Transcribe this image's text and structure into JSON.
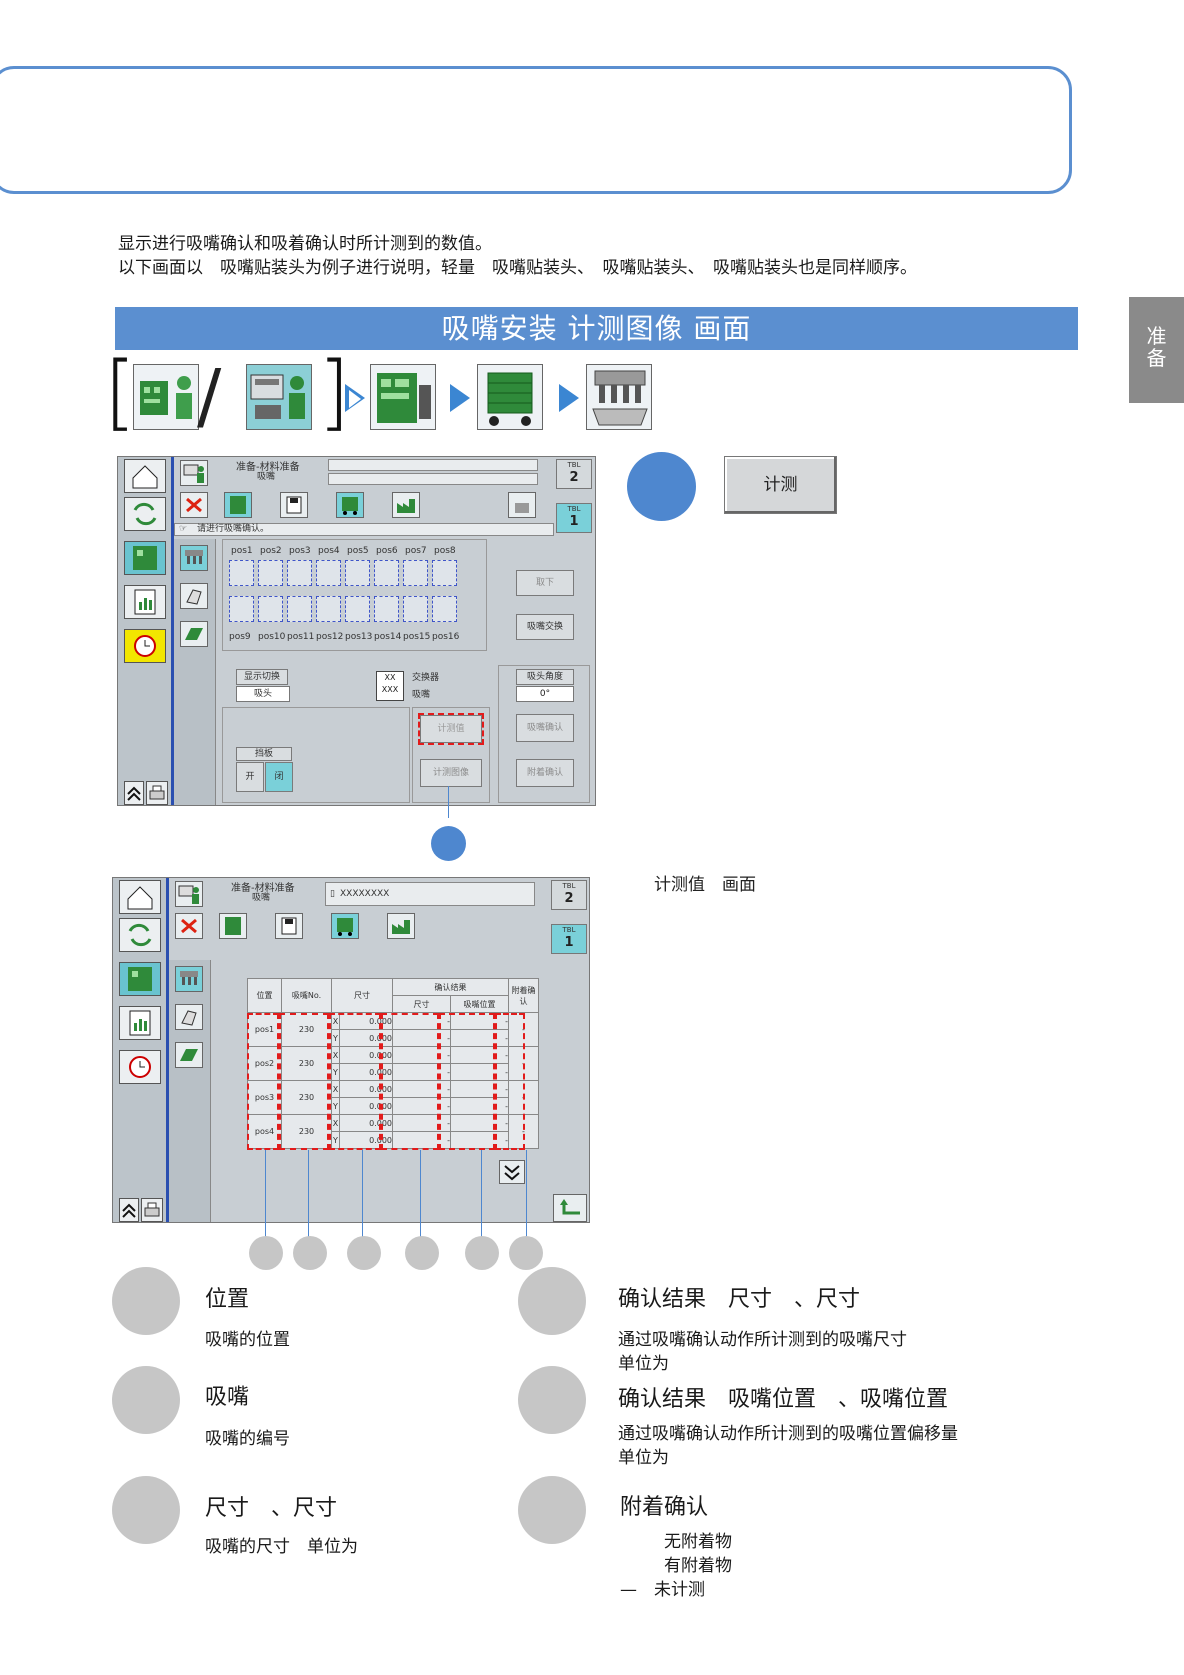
{
  "intro": {
    "line1": "显示进行吸嘴确认和吸着确认时所计测到的数值。",
    "line2": "以下画面以　吸嘴贴装头为例子进行说明，轻量　吸嘴贴装头、　吸嘴贴装头、　吸嘴贴装头也是同样顺序。"
  },
  "side_tab": {
    "line1": "准",
    "line2": "备"
  },
  "section_title": "吸嘴安装 计测图像 画面",
  "nav": {
    "bracket_open": "[",
    "slash": "/",
    "bracket_close": "]"
  },
  "screen1": {
    "header_title": "准备-材料准备",
    "header_sub": "吸嘴",
    "tbl_a": "TBL",
    "tbl_a_num": "2",
    "tbl_b": "TBL",
    "tbl_b_num": "1",
    "message": "请进行吸嘴确认。",
    "pos_top": [
      "pos1",
      "pos2",
      "pos3",
      "pos4",
      "pos5",
      "pos6",
      "pos7",
      "pos8"
    ],
    "pos_bottom": [
      "pos9",
      "pos10",
      "pos11",
      "pos12",
      "pos13",
      "pos14",
      "pos15",
      "pos16"
    ],
    "display_switch": "显示切换",
    "display_value": "吸头",
    "legend_xx": "XX",
    "legend_xxx": "XXX",
    "legend_changer": "交换器",
    "legend_nozzle": "吸嘴",
    "head_angle": "吸头角度",
    "head_angle_value": "0°",
    "btn_remove": "取下",
    "btn_nozzle_exchange": "吸嘴交换",
    "btn_measured_value": "计测值",
    "btn_measured_image": "计测图像",
    "btn_nozzle_check": "吸嘴确认",
    "btn_attach_check": "附着确认",
    "shutter": "挡板",
    "shutter_open": "开",
    "shutter_close": "闭"
  },
  "measure_button": "计测",
  "measured_screen_label": "计测值　画面",
  "screen2": {
    "header_title": "准备-材料准备",
    "header_sub": "吸嘴",
    "file_label": "XXXXXXXX",
    "tbl_a": "TBL",
    "tbl_a_num": "2",
    "tbl_b": "TBL",
    "tbl_b_num": "1",
    "col_position": "位置",
    "col_nozzle_no": "吸嘴No.",
    "col_size": "尺寸",
    "col_result": "确认结果",
    "col_result_size": "尺寸",
    "col_result_position": "吸嘴位置",
    "col_attach": "附着确认",
    "rows": [
      {
        "pos": "pos1",
        "no": "230",
        "x": "0.000",
        "y": "0.000"
      },
      {
        "pos": "pos2",
        "no": "230",
        "x": "0.000",
        "y": "0.000"
      },
      {
        "pos": "pos3",
        "no": "230",
        "x": "0.000",
        "y": "0.000"
      },
      {
        "pos": "pos4",
        "no": "230",
        "x": "0.000",
        "y": "0.000"
      }
    ],
    "axis_x": "X",
    "axis_y": "Y",
    "dash_value": "-"
  },
  "legend": {
    "position_title": "位置",
    "position_desc": "吸嘴的位置",
    "nozzle_title": "吸嘴",
    "nozzle_desc": "吸嘴的编号",
    "size_title": "尺寸　、尺寸",
    "size_desc": "吸嘴的尺寸　单位为",
    "result_size_title": "确认结果　尺寸　、尺寸",
    "result_size_desc1": "通过吸嘴确认动作所计测到的吸嘴尺寸",
    "result_size_desc2": "单位为",
    "result_pos_title": "确认结果　吸嘴位置　、吸嘴位置",
    "result_pos_desc1": "通过吸嘴确认动作所计测到的吸嘴位置偏移量",
    "result_pos_desc2": "单位为",
    "attach_title": "附着确认",
    "attach_none": "无附着物",
    "attach_have": "有附着物",
    "attach_dash": "—",
    "attach_unmeasured": "未计测"
  },
  "colors": {
    "accent_blue": "#5b8fd0",
    "highlight_red": "#e21b1b",
    "callout_grey": "#c6c6c6"
  }
}
